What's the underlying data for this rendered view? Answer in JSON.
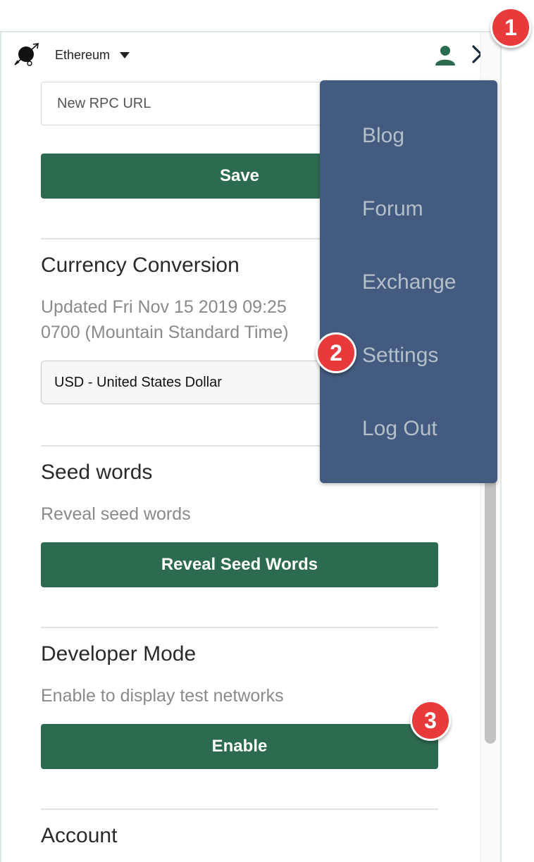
{
  "header": {
    "network_label": "Ethereum"
  },
  "network_settings": {
    "rpc_placeholder": "New RPC URL",
    "save_label": "Save"
  },
  "currency": {
    "title": "Currency Conversion",
    "updated_line1": "Updated Fri Nov 15 2019 09:25",
    "updated_line2": "0700 (Mountain Standard Time)",
    "selected": "USD - United States Dollar"
  },
  "seed": {
    "title": "Seed words",
    "description": "Reveal seed words",
    "button_label": "Reveal Seed Words"
  },
  "developer": {
    "title": "Developer Mode",
    "description": "Enable to display test networks",
    "button_label": "Enable"
  },
  "account": {
    "title": "Account"
  },
  "menu": {
    "items": [
      {
        "label": "Blog"
      },
      {
        "label": "Forum"
      },
      {
        "label": "Exchange"
      },
      {
        "label": "Settings"
      },
      {
        "label": "Log Out"
      }
    ]
  },
  "annotations": [
    "1",
    "2",
    "3"
  ],
  "colors": {
    "primary_green": "#2d6b50",
    "menu_bg": "#425b7e",
    "badge_red": "#e83a3a"
  }
}
